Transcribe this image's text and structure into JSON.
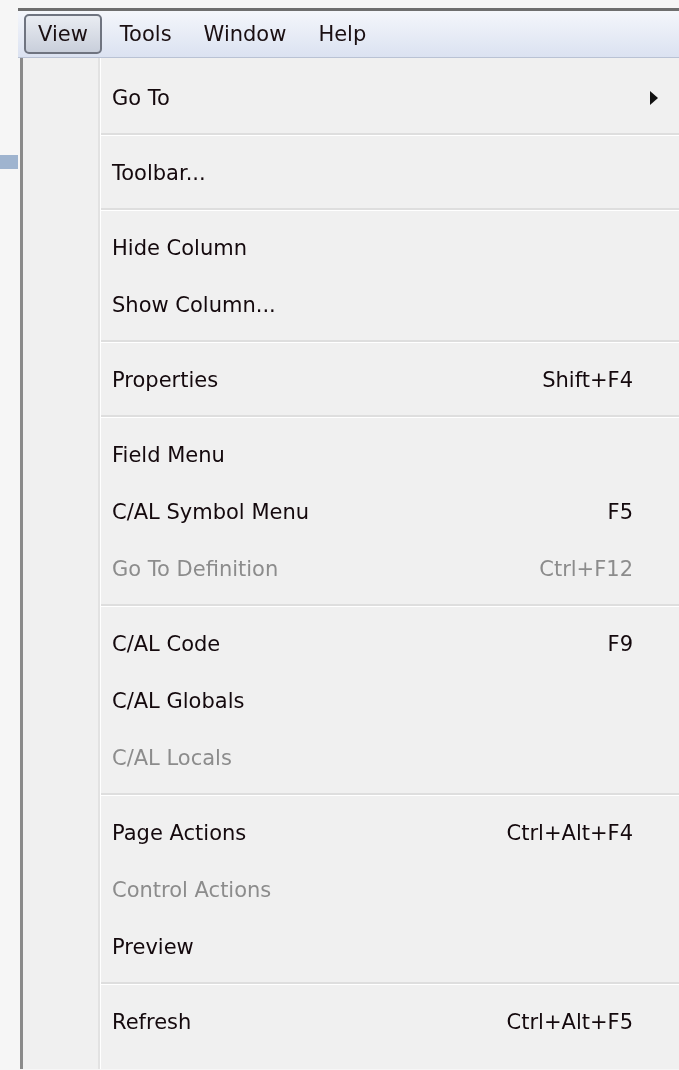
{
  "menu_bar": [
    {
      "label": "View",
      "selected": true
    },
    {
      "label": "Tools",
      "selected": false
    },
    {
      "label": "Window",
      "selected": false
    },
    {
      "label": "Help",
      "selected": false
    }
  ],
  "menu": {
    "sections": [
      [
        {
          "label": "Go To",
          "submenu": true,
          "disabled": false
        }
      ],
      [
        {
          "label": "Toolbar...",
          "disabled": false
        }
      ],
      [
        {
          "label": "Hide Column",
          "disabled": false
        },
        {
          "label": "Show Column...",
          "disabled": false
        }
      ],
      [
        {
          "label": "Properties",
          "shortcut": "Shift+F4",
          "disabled": false
        }
      ],
      [
        {
          "label": "Field Menu",
          "disabled": false
        },
        {
          "label": "C/AL Symbol Menu",
          "shortcut": "F5",
          "disabled": false
        },
        {
          "label": "Go To Definition",
          "shortcut": "Ctrl+F12",
          "disabled": true
        }
      ],
      [
        {
          "label": "C/AL Code",
          "shortcut": "F9",
          "disabled": false
        },
        {
          "label": "C/AL Globals",
          "disabled": false
        },
        {
          "label": "C/AL Locals",
          "disabled": true
        }
      ],
      [
        {
          "label": "Page Actions",
          "shortcut": "Ctrl+Alt+F4",
          "disabled": false
        },
        {
          "label": "Control Actions",
          "disabled": true
        },
        {
          "label": "Preview",
          "disabled": false
        }
      ],
      [
        {
          "label": "Refresh",
          "shortcut": "Ctrl+Alt+F5",
          "disabled": false
        }
      ]
    ]
  }
}
